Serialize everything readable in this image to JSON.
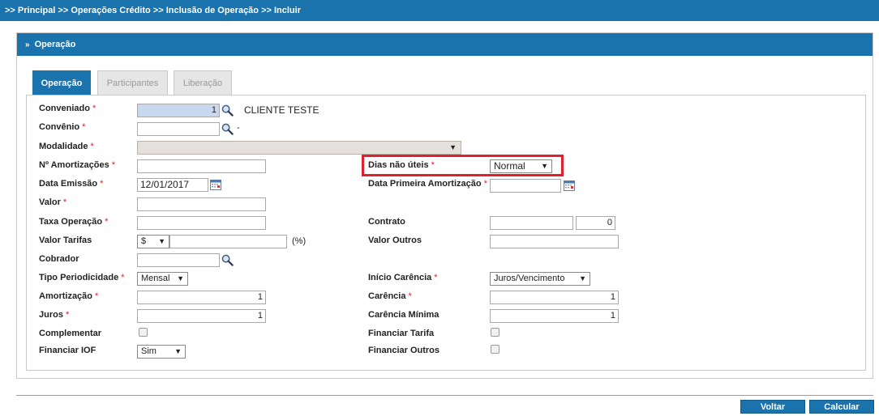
{
  "breadcrumb": ">> Principal >> Operações Crédito >> Inclusão de Operação >> Incluir",
  "panel": {
    "title": "Operação"
  },
  "tabs": [
    {
      "label": "Operação",
      "active": true
    },
    {
      "label": "Participantes",
      "active": false
    },
    {
      "label": "Liberação",
      "active": false
    }
  ],
  "form": {
    "conveniado": {
      "label": "Conveniado",
      "value": "1",
      "name": "CLIENTE TESTE"
    },
    "convenio": {
      "label": "Convênio",
      "value": "",
      "suffix": "-"
    },
    "modalidade": {
      "label": "Modalidade",
      "value": ""
    },
    "n_amortizacoes": {
      "label": "Nº Amortizações",
      "value": ""
    },
    "dias_nao_uteis": {
      "label": "Dias não úteis",
      "value": "Normal"
    },
    "data_emissao": {
      "label": "Data Emissão",
      "value": "12/01/2017"
    },
    "data_primeira_amortizacao": {
      "label": "Data Primeira Amortização",
      "value": ""
    },
    "valor": {
      "label": "Valor",
      "value": ""
    },
    "taxa_operacao": {
      "label": "Taxa Operação",
      "value": ""
    },
    "contrato": {
      "label": "Contrato",
      "value": "",
      "value2": "0"
    },
    "valor_tarifas": {
      "label": "Valor Tarifas",
      "currency": "$",
      "value": "",
      "unit": "(%)"
    },
    "valor_outros": {
      "label": "Valor Outros",
      "value": ""
    },
    "cobrador": {
      "label": "Cobrador",
      "value": ""
    },
    "tipo_periodicidade": {
      "label": "Tipo Periodicidade",
      "value": "Mensal"
    },
    "inicio_carencia": {
      "label": "Início Carência",
      "value": "Juros/Vencimento"
    },
    "amortizacao": {
      "label": "Amortização",
      "value": "1"
    },
    "carencia": {
      "label": "Carência",
      "value": "1"
    },
    "juros": {
      "label": "Juros",
      "value": "1"
    },
    "carencia_minima": {
      "label": "Carência Mínima",
      "value": "1"
    },
    "complementar": {
      "label": "Complementar",
      "checked": false
    },
    "financiar_tarifa": {
      "label": "Financiar Tarifa",
      "checked": false
    },
    "financiar_iof": {
      "label": "Financiar IOF",
      "value": "Sim"
    },
    "financiar_outros": {
      "label": "Financiar Outros",
      "checked": false
    }
  },
  "required_marker": "*",
  "buttons": {
    "voltar": "Voltar",
    "calcular": "Calcular"
  },
  "colors": {
    "primary": "#1a73ad",
    "required": "#e02020",
    "highlight": "#e0202c"
  }
}
